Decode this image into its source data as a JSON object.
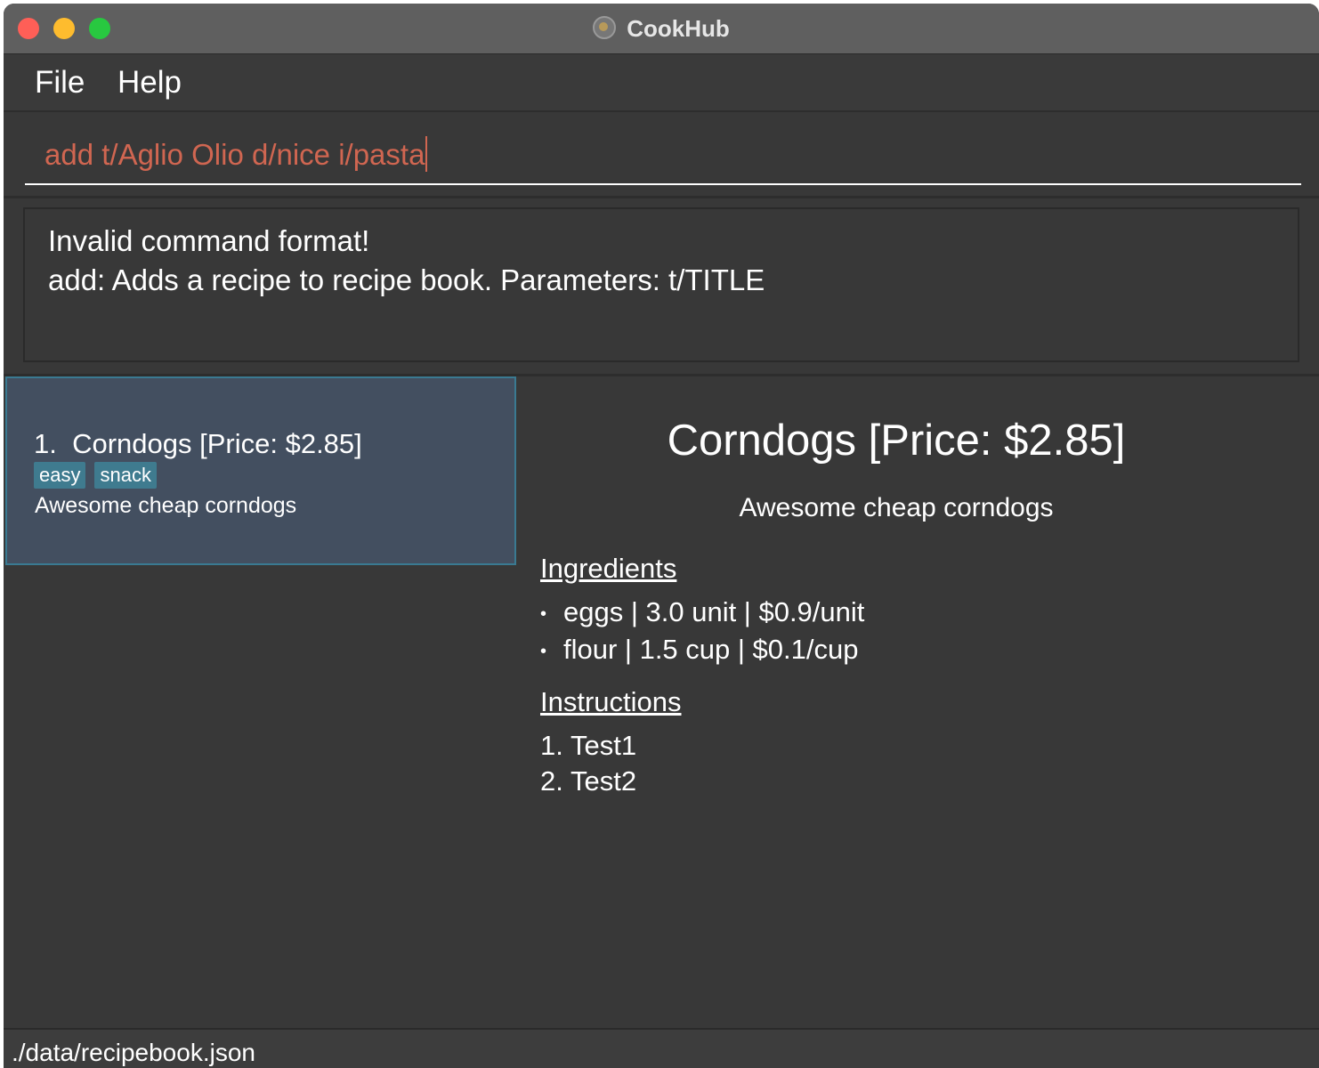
{
  "window": {
    "title": "CookHub"
  },
  "menu": {
    "file": "File",
    "help": "Help"
  },
  "command": {
    "value": "add t/Aglio Olio d/nice i/pasta"
  },
  "result": {
    "line1": "Invalid command format!",
    "line2": "add: Adds a recipe to recipe book. Parameters: t/TITLE"
  },
  "recipe_list": [
    {
      "index": "1.",
      "title": "Corndogs [Price: $2.85]",
      "tags": [
        "easy",
        "snack"
      ],
      "description": "Awesome cheap corndogs"
    }
  ],
  "detail": {
    "title": "Corndogs [Price: $2.85]",
    "description": "Awesome cheap corndogs",
    "ingredients_heading": "Ingredients",
    "ingredients": [
      "eggs | 3.0 unit | $0.9/unit",
      "flour | 1.5 cup | $0.1/cup"
    ],
    "instructions_heading": "Instructions",
    "instructions": [
      "Test1",
      "Test2"
    ]
  },
  "status": {
    "file_path": "./data/recipebook.json"
  },
  "colors": {
    "background": "#383838",
    "command_text": "#d06651",
    "card_background": "#434f60",
    "tag_background": "#3f7b8f"
  }
}
